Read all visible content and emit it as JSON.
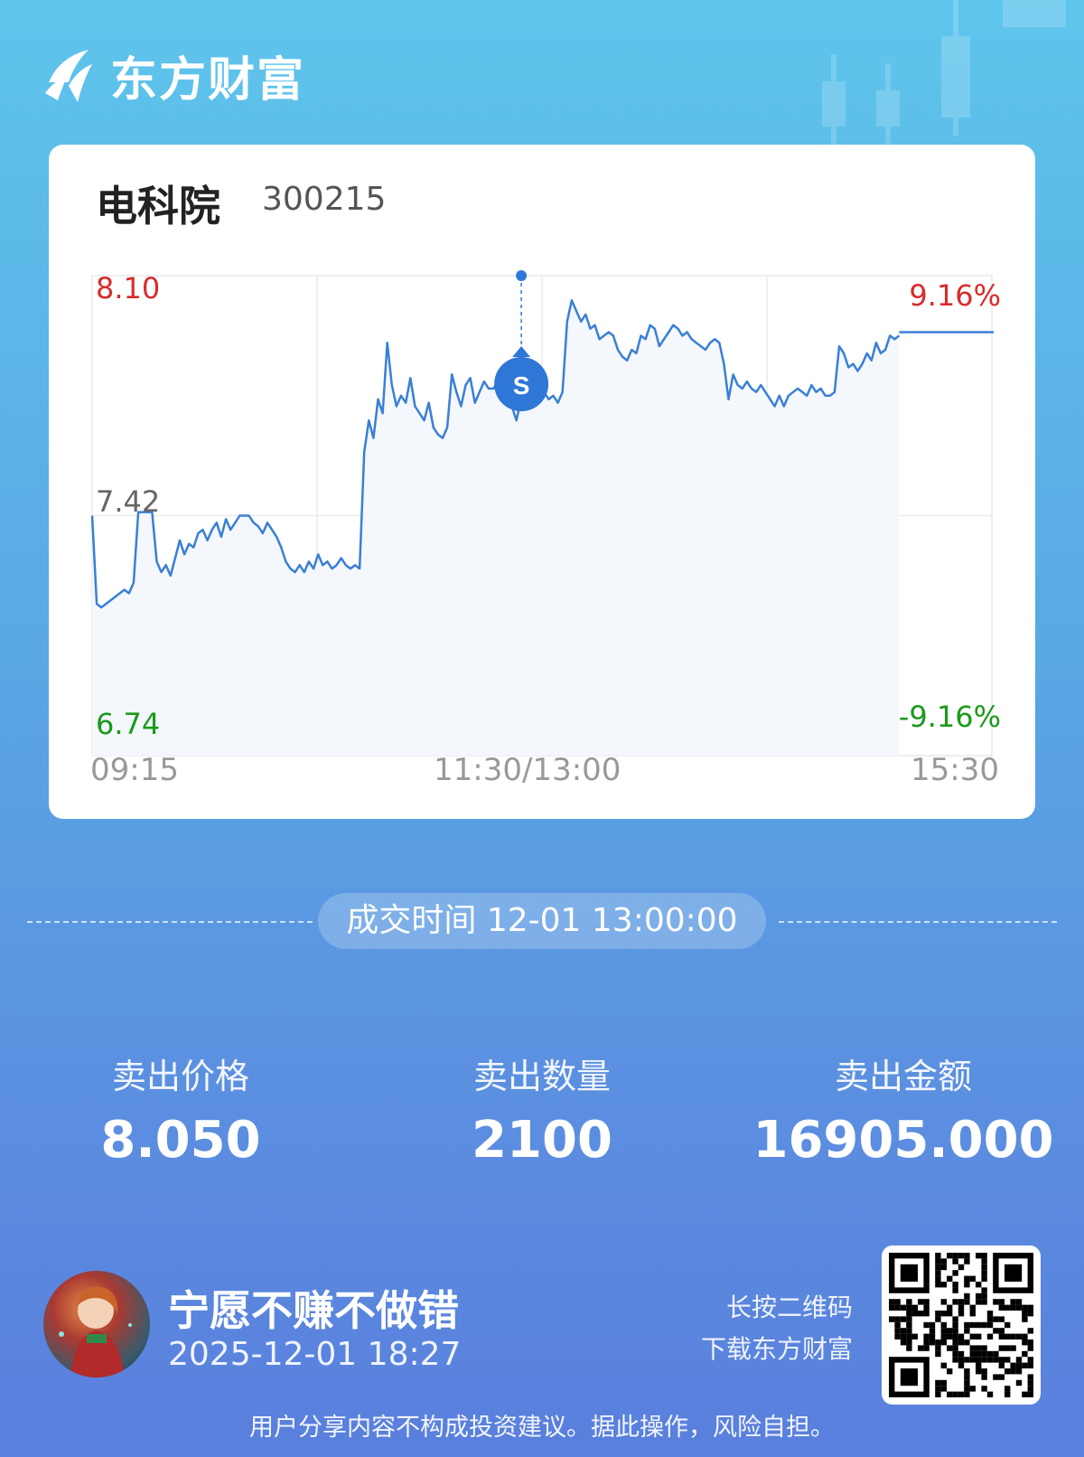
{
  "app": {
    "brand_name": "东方财富"
  },
  "stock": {
    "name": "电科院",
    "code": "300215"
  },
  "chart_data": {
    "type": "line",
    "x_ticks": [
      "09:15",
      "11:30/13:00",
      "15:30"
    ],
    "y_left_ticks": [
      "8.10",
      "7.42",
      "6.74"
    ],
    "y_right_ticks": [
      "9.16%",
      "-9.16%"
    ],
    "ylim": [
      6.74,
      8.1
    ],
    "prev_close": 7.42,
    "series": [
      {
        "values": [
          7.42,
          7.17,
          7.16,
          7.17,
          7.18,
          7.19,
          7.2,
          7.21,
          7.2,
          7.23,
          7.43,
          7.43,
          7.43,
          7.43,
          7.29,
          7.26,
          7.28,
          7.25,
          7.3,
          7.35,
          7.31,
          7.34,
          7.33,
          7.37,
          7.38,
          7.35,
          7.38,
          7.4,
          7.36,
          7.41,
          7.38,
          7.4,
          7.42,
          7.42,
          7.42,
          7.4,
          7.39,
          7.37,
          7.4,
          7.38,
          7.36,
          7.33,
          7.29,
          7.27,
          7.26,
          7.28,
          7.26,
          7.29,
          7.27,
          7.31,
          7.28,
          7.29,
          7.27,
          7.28,
          7.3,
          7.28,
          7.27,
          7.28,
          7.27,
          7.6,
          7.69,
          7.64,
          7.75,
          7.71,
          7.91,
          7.79,
          7.73,
          7.76,
          7.74,
          7.81,
          7.73,
          7.71,
          7.69,
          7.74,
          7.67,
          7.65,
          7.64,
          7.67,
          7.82,
          7.77,
          7.73,
          7.79,
          7.81,
          7.74,
          7.77,
          7.8,
          7.78,
          7.78,
          7.8,
          7.79,
          7.74,
          7.73,
          7.69,
          7.75,
          7.73,
          7.78,
          7.81,
          7.75,
          7.77,
          7.75,
          7.76,
          7.74,
          7.77,
          7.97,
          8.03,
          8.0,
          7.97,
          7.99,
          7.95,
          7.96,
          7.92,
          7.93,
          7.94,
          7.93,
          7.89,
          7.87,
          7.86,
          7.89,
          7.88,
          7.93,
          7.92,
          7.96,
          7.95,
          7.9,
          7.92,
          7.94,
          7.96,
          7.95,
          7.93,
          7.94,
          7.92,
          7.91,
          7.9,
          7.89,
          7.91,
          7.92,
          7.91,
          7.85,
          7.75,
          7.82,
          7.79,
          7.78,
          7.8,
          7.78,
          7.77,
          7.79,
          7.77,
          7.75,
          7.73,
          7.76,
          7.73,
          7.76,
          7.77,
          7.78,
          7.77,
          7.76,
          7.79,
          7.77,
          7.78,
          7.76,
          7.76,
          7.77,
          7.9,
          7.88,
          7.84,
          7.85,
          7.83,
          7.85,
          7.88,
          7.86,
          7.91,
          7.88,
          7.89,
          7.93,
          7.92,
          7.93
        ],
        "end_value": 7.94,
        "marker": {
          "label": "S",
          "time": "13:00",
          "price": 8.1
        }
      }
    ]
  },
  "trade_time": "成交时间 12-01 13:00:00",
  "stats": [
    {
      "label": "卖出价格",
      "value": "8.050"
    },
    {
      "label": "卖出数量",
      "value": "2100"
    },
    {
      "label": "卖出金额",
      "value": "16905.000"
    }
  ],
  "user": {
    "nickname": "宁愿不赚不做错",
    "post_time": "2025-12-01 18:27"
  },
  "qr_hint": {
    "line1": "长按二维码",
    "line2": "下载东方财富"
  },
  "disclaimer": "用户分享内容不构成投资建议。据此操作，风险自担。",
  "colors": {
    "line": "#3a7fd5",
    "up": "#d92b2b",
    "down": "#1a9a1a",
    "marker": "#2f77d6"
  }
}
